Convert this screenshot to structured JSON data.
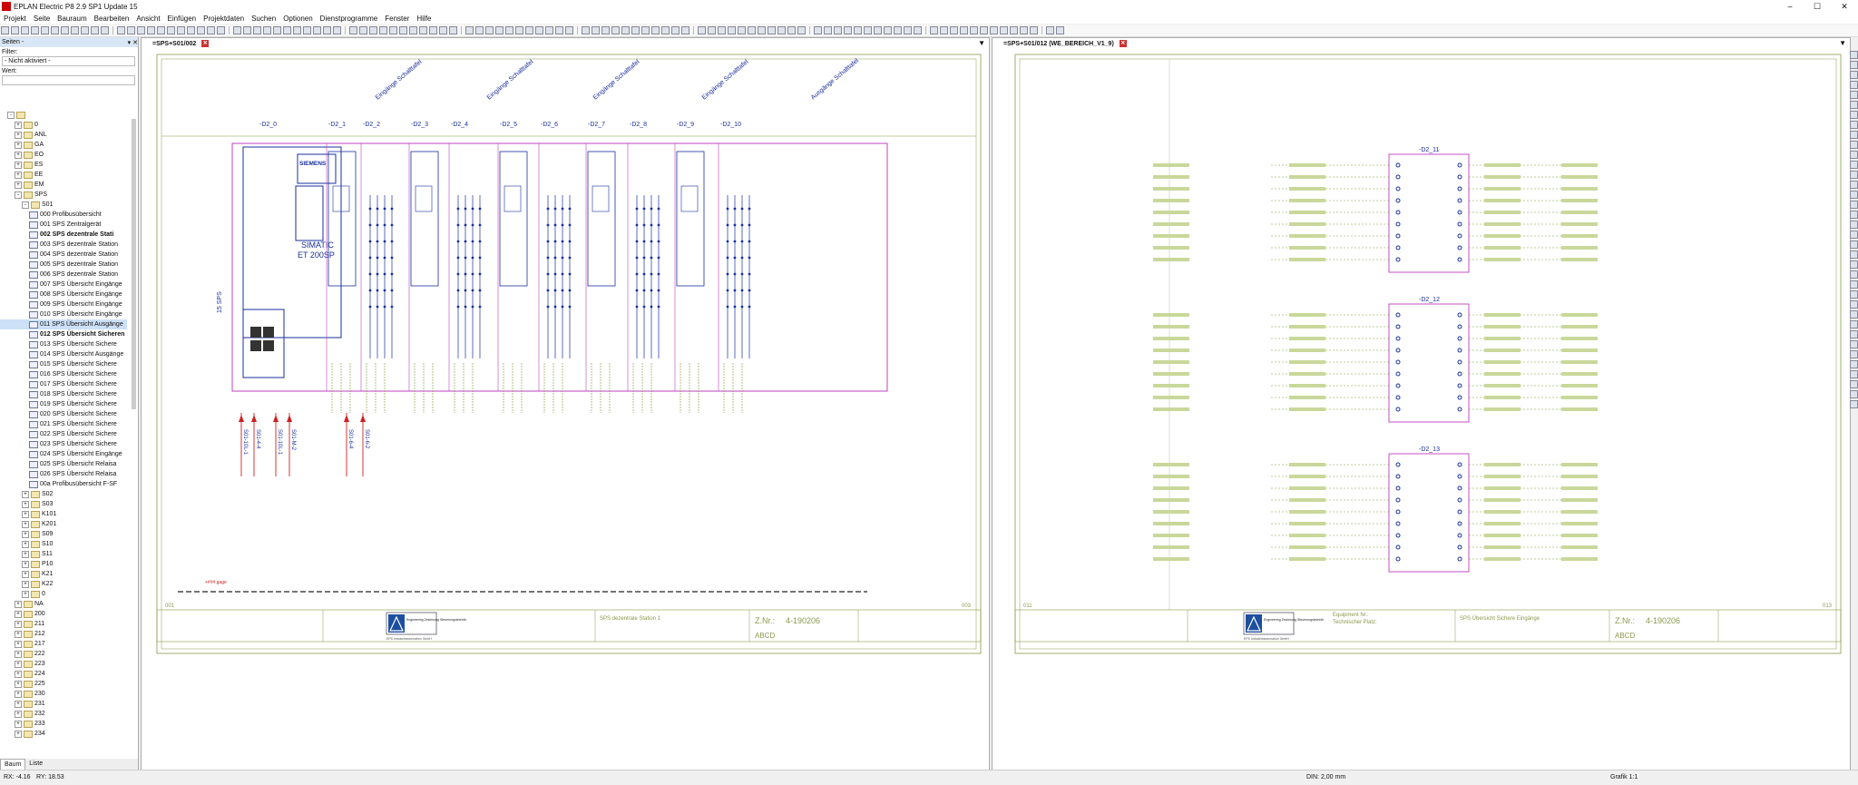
{
  "window": {
    "title": "EPLAN Electric P8 2.9 SP1 Update 15",
    "controls": [
      "–",
      "☐",
      "✕"
    ]
  },
  "menu": [
    "Projekt",
    "Seite",
    "Bauraum",
    "Bearbeiten",
    "Ansicht",
    "Einfügen",
    "Projektdaten",
    "Suchen",
    "Optionen",
    "Dienstprogramme",
    "Fenster",
    "Hilfe"
  ],
  "left_panel": {
    "title": "Seiten - ",
    "filter_label": "Filter:",
    "filter_value": "- Nicht aktiviert -",
    "value_label": "Wert:",
    "tree": [
      {
        "label": "",
        "indent": 1,
        "kind": "folder",
        "exp": "-"
      },
      {
        "label": "0",
        "indent": 2,
        "kind": "folder",
        "exp": "+"
      },
      {
        "label": "ANL",
        "indent": 2,
        "kind": "folder",
        "exp": "+"
      },
      {
        "label": "GA",
        "indent": 2,
        "kind": "folder",
        "exp": "+"
      },
      {
        "label": "EO",
        "indent": 2,
        "kind": "folder",
        "exp": "+"
      },
      {
        "label": "ES",
        "indent": 2,
        "kind": "folder",
        "exp": "+"
      },
      {
        "label": "EE",
        "indent": 2,
        "kind": "folder",
        "exp": "+"
      },
      {
        "label": "EM",
        "indent": 2,
        "kind": "folder",
        "exp": "+"
      },
      {
        "label": "SPS",
        "indent": 2,
        "kind": "folder",
        "exp": "-"
      },
      {
        "label": "S01",
        "indent": 3,
        "kind": "folder",
        "exp": "-"
      },
      {
        "label": "000 Profibusübersicht",
        "indent": 4,
        "kind": "page"
      },
      {
        "label": "001 SPS Zentralgerät",
        "indent": 4,
        "kind": "page"
      },
      {
        "label": "002 SPS dezentrale Stati",
        "indent": 4,
        "kind": "page",
        "bold": true
      },
      {
        "label": "003 SPS dezentrale Station",
        "indent": 4,
        "kind": "page"
      },
      {
        "label": "004 SPS dezentrale Station",
        "indent": 4,
        "kind": "page"
      },
      {
        "label": "005 SPS dezentrale Station",
        "indent": 4,
        "kind": "page"
      },
      {
        "label": "006 SPS dezentrale Station",
        "indent": 4,
        "kind": "page"
      },
      {
        "label": "007 SPS Übersicht Eingänge",
        "indent": 4,
        "kind": "page"
      },
      {
        "label": "008 SPS Übersicht Eingänge",
        "indent": 4,
        "kind": "page"
      },
      {
        "label": "009 SPS Übersicht Eingänge",
        "indent": 4,
        "kind": "page"
      },
      {
        "label": "010 SPS Übersicht Eingänge",
        "indent": 4,
        "kind": "page"
      },
      {
        "label": "011 SPS Übersicht Ausgänge",
        "indent": 4,
        "kind": "page",
        "selected": true
      },
      {
        "label": "012 SPS Übersicht Sicheren",
        "indent": 4,
        "kind": "page",
        "bold": true
      },
      {
        "label": "013 SPS Übersicht Sichere",
        "indent": 4,
        "kind": "page"
      },
      {
        "label": "014 SPS Übersicht Ausgänge",
        "indent": 4,
        "kind": "page"
      },
      {
        "label": "015 SPS Übersicht Sichere",
        "indent": 4,
        "kind": "page"
      },
      {
        "label": "016 SPS Übersicht Sichere",
        "indent": 4,
        "kind": "page"
      },
      {
        "label": "017 SPS Übersicht Sichere",
        "indent": 4,
        "kind": "page"
      },
      {
        "label": "018 SPS Übersicht Sichere",
        "indent": 4,
        "kind": "page"
      },
      {
        "label": "019 SPS Übersicht Sichere",
        "indent": 4,
        "kind": "page"
      },
      {
        "label": "020 SPS Übersicht Sichere",
        "indent": 4,
        "kind": "page"
      },
      {
        "label": "021 SPS Übersicht Sichere",
        "indent": 4,
        "kind": "page"
      },
      {
        "label": "022 SPS Übersicht Sichere",
        "indent": 4,
        "kind": "page"
      },
      {
        "label": "023 SPS Übersicht Sichere",
        "indent": 4,
        "kind": "page"
      },
      {
        "label": "024 SPS Übersicht Eingänge",
        "indent": 4,
        "kind": "page"
      },
      {
        "label": "025 SPS Übersicht Relaisa",
        "indent": 4,
        "kind": "page"
      },
      {
        "label": "026 SPS Übersicht Relaisa",
        "indent": 4,
        "kind": "page"
      },
      {
        "label": "00a Profibusübersicht F-SF",
        "indent": 4,
        "kind": "page"
      },
      {
        "label": "S02",
        "indent": 3,
        "kind": "folder",
        "exp": "+"
      },
      {
        "label": "S03",
        "indent": 3,
        "kind": "folder",
        "exp": "+"
      },
      {
        "label": "K101",
        "indent": 3,
        "kind": "folder",
        "exp": "+"
      },
      {
        "label": "K201",
        "indent": 3,
        "kind": "folder",
        "exp": "+"
      },
      {
        "label": "S09",
        "indent": 3,
        "kind": "folder",
        "exp": "+"
      },
      {
        "label": "S10",
        "indent": 3,
        "kind": "folder",
        "exp": "+"
      },
      {
        "label": "S11",
        "indent": 3,
        "kind": "folder",
        "exp": "+"
      },
      {
        "label": "P10",
        "indent": 3,
        "kind": "folder",
        "exp": "+"
      },
      {
        "label": "K21",
        "indent": 3,
        "kind": "folder",
        "exp": "+"
      },
      {
        "label": "K22",
        "indent": 3,
        "kind": "folder",
        "exp": "+"
      },
      {
        "label": "0",
        "indent": 3,
        "kind": "folder",
        "exp": "+"
      },
      {
        "label": "NA",
        "indent": 2,
        "kind": "folder",
        "exp": "+"
      },
      {
        "label": "200",
        "indent": 2,
        "kind": "folder",
        "exp": "+"
      },
      {
        "label": "211",
        "indent": 2,
        "kind": "folder",
        "exp": "+"
      },
      {
        "label": "212",
        "indent": 2,
        "kind": "folder",
        "exp": "+"
      },
      {
        "label": "217",
        "indent": 2,
        "kind": "folder",
        "exp": "+"
      },
      {
        "label": "222",
        "indent": 2,
        "kind": "folder",
        "exp": "+"
      },
      {
        "label": "223",
        "indent": 2,
        "kind": "folder",
        "exp": "+"
      },
      {
        "label": "224",
        "indent": 2,
        "kind": "folder",
        "exp": "+"
      },
      {
        "label": "225",
        "indent": 2,
        "kind": "folder",
        "exp": "+"
      },
      {
        "label": "230",
        "indent": 2,
        "kind": "folder",
        "exp": "+"
      },
      {
        "label": "231",
        "indent": 2,
        "kind": "folder",
        "exp": "+"
      },
      {
        "label": "232",
        "indent": 2,
        "kind": "folder",
        "exp": "+"
      },
      {
        "label": "233",
        "indent": 2,
        "kind": "folder",
        "exp": "+"
      },
      {
        "label": "234",
        "indent": 2,
        "kind": "folder",
        "exp": "+"
      }
    ],
    "tabs": [
      "Baum",
      "Liste"
    ]
  },
  "doc_left": {
    "tab_label": "=SPS+S01/002",
    "modules": [
      "-D2_0",
      "-D2_1",
      "-D2_2",
      "-D2_3",
      "-D2_4",
      "-D2_5",
      "-D2_6",
      "-D2_7",
      "-D2_8",
      "-D2_9",
      "-D2_10"
    ],
    "group_labels": [
      "Eingänge Schalttafel",
      "Eingänge Schalttafel",
      "Eingänge Schalttafel",
      "Eingänge Schalttafel",
      "Ausgänge Schalttafel"
    ],
    "head_module": {
      "brand": "SIEMENS",
      "name": "SIMATIC",
      "model": "ET 200SP"
    },
    "vertical_label": "15 SPS",
    "wire_labels": [
      "S01-10L-1",
      "S01-4-4",
      "S01-10L-1",
      "S01-M-2",
      "S01-6-4",
      "S01-6-2"
    ],
    "bus_label": "+###  gage",
    "title_block": {
      "description": "SPS dezentrale Station 1",
      "zn_label": "Z.Nr.:",
      "zn_value": "4-190206",
      "letters": "ABCD",
      "company": "EPS Industrieautomation GmbH",
      "logo_text": "Engineering Zeichnung Steuerungstechnik"
    },
    "page_num_left": "001",
    "page_num_right": "003"
  },
  "doc_right": {
    "tab_label": "=SPS+S01/012 (WE_BEREICH_V1_9)",
    "modules": [
      "-D2_11",
      "-D2_12",
      "-D2_13"
    ],
    "title_block": {
      "description": "SPS Übersicht Sichere Eingänge",
      "zn_label": "Z.Nr.:",
      "zn_value": "4-190206",
      "letters": "ABCD",
      "company": "EPS Industrieautomation GmbH",
      "logo_text": "Engineering Zeichnung Steuerungstechnik",
      "equipment_label": "Equipment Nr.:",
      "tech_label": "Technischer Platz:"
    },
    "page_num_left": "011",
    "page_num_right": "013"
  },
  "status": {
    "rx": "RX: -4.16",
    "ry": "RY: 18.53",
    "grid": "DIN: 2,00 mm",
    "scale": "Grafik 1:1"
  },
  "colors": {
    "schematic_blue": "#1a2f9e",
    "schematic_magenta": "#c040c0",
    "schematic_red": "#d02020",
    "schematic_green": "#7a9a30",
    "frame_green": "#8a9a4a"
  }
}
